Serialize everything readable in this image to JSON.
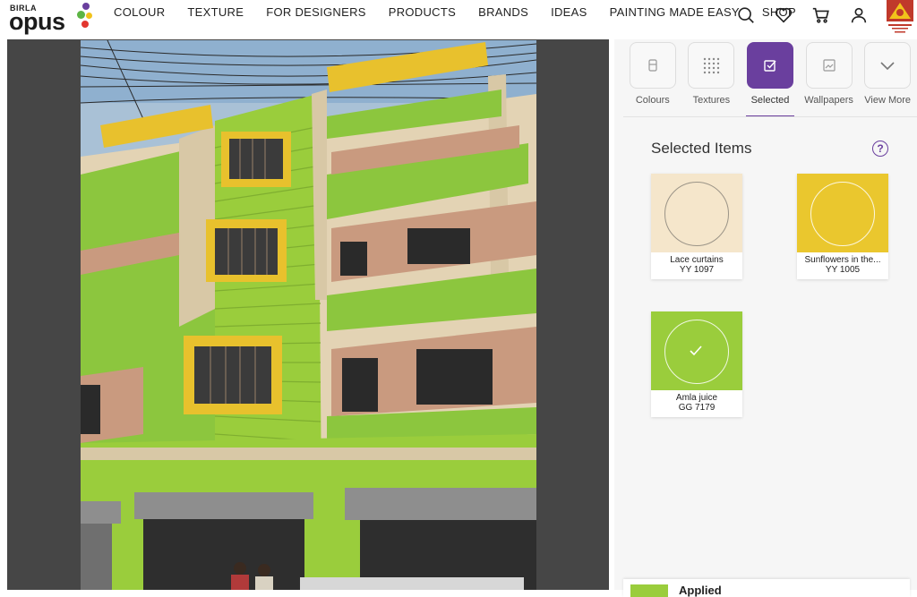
{
  "brand": {
    "small": "BIRLA",
    "name": "opus"
  },
  "nav": {
    "items": [
      "COLOUR",
      "TEXTURE",
      "FOR DESIGNERS",
      "PRODUCTS",
      "BRANDS",
      "IDEAS",
      "PAINTING MADE EASY",
      "SHOP"
    ],
    "icons": [
      "search-icon",
      "heart-icon",
      "cart-icon",
      "user-icon"
    ]
  },
  "tabs": [
    {
      "label": "Colours",
      "icon": "paint-bucket-icon",
      "active": false
    },
    {
      "label": "Textures",
      "icon": "texture-grid-icon",
      "active": false
    },
    {
      "label": "Selected",
      "icon": "checkbox-icon",
      "active": true
    },
    {
      "label": "Wallpapers",
      "icon": "wallpaper-icon",
      "active": false
    },
    {
      "label": "View More",
      "icon": "chevron-down-icon",
      "active": false
    }
  ],
  "selected": {
    "title": "Selected Items",
    "help": "?",
    "items": [
      {
        "name": "Lace curtains",
        "code": "YY 1097",
        "color": "#f5e6cb",
        "checked": false
      },
      {
        "name": "Sunflowers in the...",
        "code": "YY 1005",
        "color": "#eac72e",
        "checked": false
      },
      {
        "name": "Amla juice",
        "code": "GG 7179",
        "color": "#9acd3c",
        "checked": true
      }
    ]
  },
  "applied": {
    "label": "Applied",
    "color": "#9acd3c"
  },
  "colors": {
    "accent": "#6a3f9e",
    "viewer_bg": "#464646",
    "panel_bg": "#f6f6f6"
  }
}
